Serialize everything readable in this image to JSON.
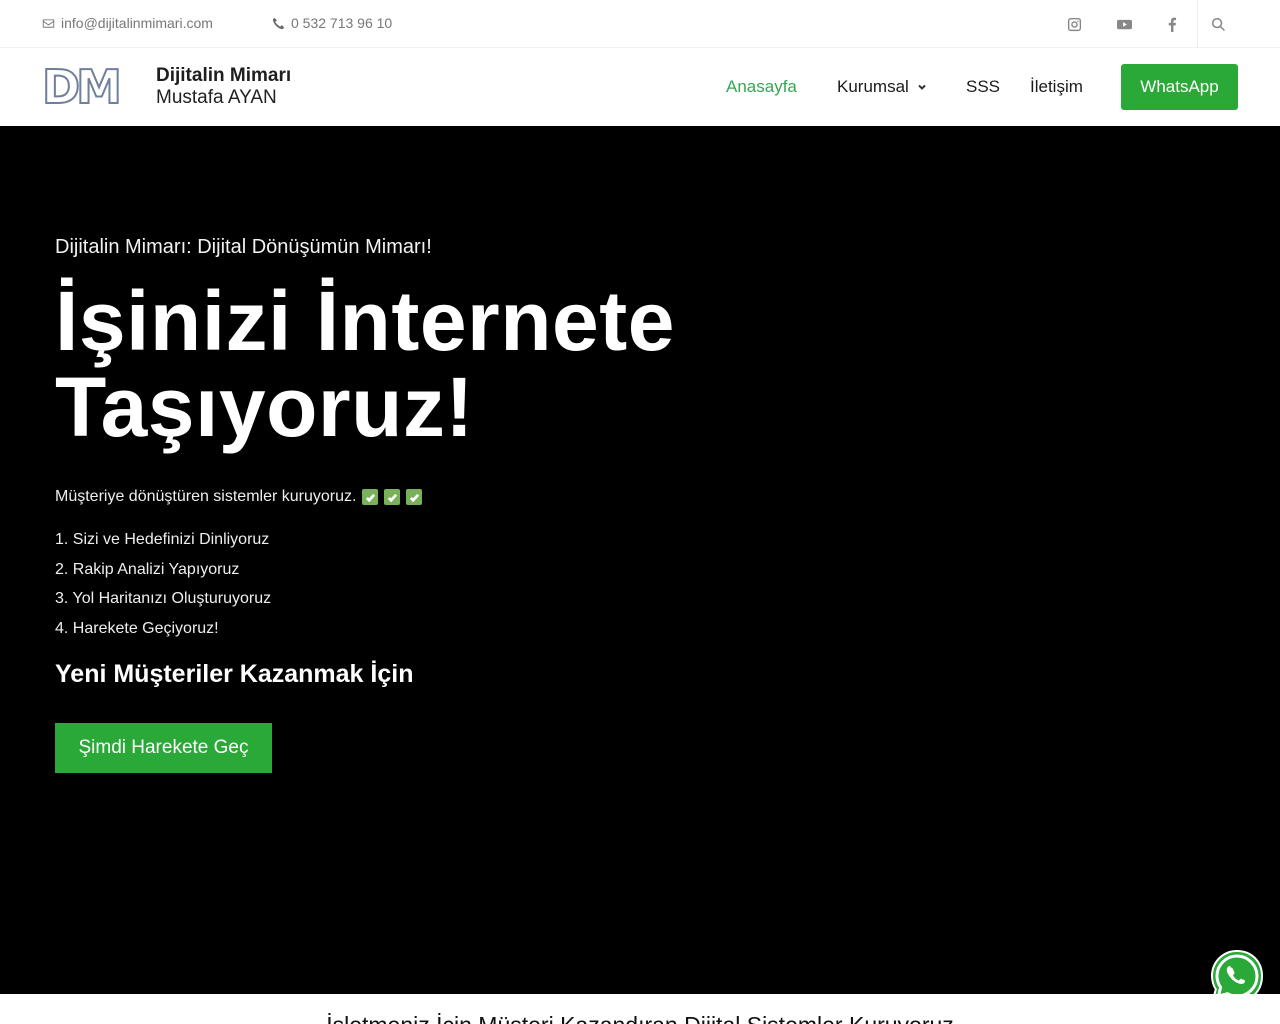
{
  "topbar": {
    "email": "info@dijitalinmimari.com",
    "phone": "0 532 713 96 10",
    "icons": [
      "envelope-icon",
      "phone-icon",
      "instagram-icon",
      "youtube-icon",
      "facebook-icon",
      "search-icon"
    ]
  },
  "logo": {
    "mark": "DM",
    "line1": "Dijitalin Mimarı",
    "line2": "Mustafa AYAN"
  },
  "nav": {
    "home": "Anasayfa",
    "kurumsal": "Kurumsal",
    "sss": "SSS",
    "iletisim": "İletişim",
    "whatsapp": "WhatsApp"
  },
  "hero": {
    "eyebrow": "Dijitalin Mimarı: Dijital Dönüşümün Mimarı!",
    "title_line1": "İşinizi İnternete",
    "title_line2": "Taşıyoruz!",
    "lead": "Müşteriye dönüştüren sistemler kuruyoruz.",
    "steps": [
      "1. Sizi ve Hedefinizi Dinliyoruz",
      "2. Rakip Analizi Yapıyoruz",
      "3. Yol Haritanızı Oluşturuyoruz",
      "4. Harekete Geçiyoruz!"
    ],
    "subheading": "Yeni Müşteriler Kazanmak İçin",
    "cta": "Şimdi Harekete Geç"
  },
  "band": {
    "text": "İşletmeniz İçin Müşteri Kazandıran Dijital Sistemler Kuruyoruz"
  },
  "colors": {
    "accent_green": "#2aa838",
    "active_nav": "#32a852",
    "hero_bg": "#000000"
  }
}
